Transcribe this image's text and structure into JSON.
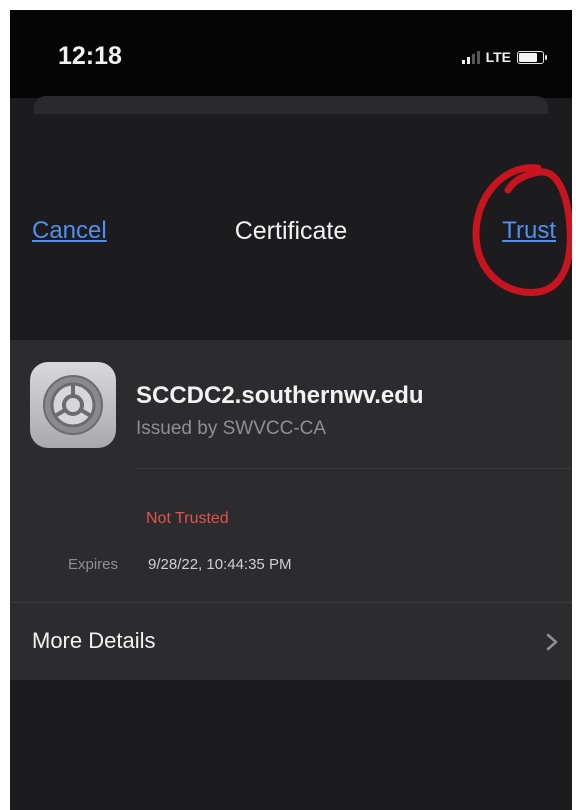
{
  "status_bar": {
    "time": "12:18",
    "network": "LTE"
  },
  "nav": {
    "cancel_label": "Cancel",
    "title": "Certificate",
    "trust_label": "Trust"
  },
  "certificate": {
    "icon": "settings-gear-icon",
    "name": "SCCDC2.southernwv.edu",
    "issuer": "Issued by SWVCC-CA",
    "status": "Not Trusted",
    "expires_label": "Expires",
    "expires_value": "9/28/22, 10:44:35 PM"
  },
  "more_details": {
    "label": "More Details",
    "icon": "chevron-right-icon"
  },
  "colors": {
    "link_blue": "#4f90f0",
    "warning_red": "#e0524f",
    "annotation_red": "#c8141e",
    "background": "#1c1c1e",
    "group_background": "#2c2c2e"
  }
}
